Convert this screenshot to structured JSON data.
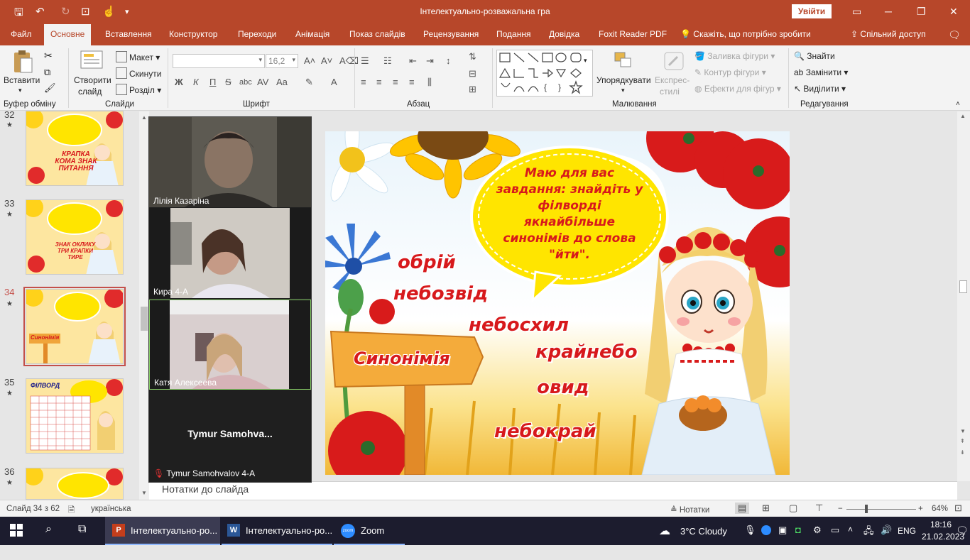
{
  "window": {
    "title": "Інтелектуально-розважальна гра",
    "signin": "Увійти"
  },
  "tabs": [
    "Файл",
    "Основне",
    "Вставлення",
    "Конструктор",
    "Переходи",
    "Анімація",
    "Показ слайдів",
    "Рецензування",
    "Подання",
    "Довідка",
    "Foxit Reader PDF"
  ],
  "tell_me": "Скажіть, що потрібно зробити",
  "share": "Спільний доступ",
  "ribbon": {
    "clipboard": {
      "paste": "Вставити",
      "label": "Буфер обміну"
    },
    "slides": {
      "new_slide_1": "Створити",
      "new_slide_2": "слайд",
      "layout": "Макет",
      "reset": "Скинути",
      "section": "Розділ",
      "label": "Слайди"
    },
    "font": {
      "size": "16,2",
      "bold": "Ж",
      "italic": "К",
      "underline": "П",
      "strike": "S",
      "spacing": "Aa",
      "label": "Шрифт"
    },
    "paragraph": {
      "label": "Абзац"
    },
    "drawing": {
      "arrange": "Упорядкувати",
      "quick_styles_1": "Експрес-",
      "quick_styles_2": "стилі",
      "fill": "Заливка фігури",
      "outline": "Контур фігури",
      "effects": "Ефекти для фігур",
      "label": "Малювання"
    },
    "editing": {
      "find": "Знайти",
      "replace": "Замінити",
      "select": "Виділити",
      "label": "Редагування"
    }
  },
  "slides_panel": [
    {
      "num": "32",
      "star": "★"
    },
    {
      "num": "33",
      "star": "★"
    },
    {
      "num": "34",
      "star": "★"
    },
    {
      "num": "35",
      "star": "★"
    },
    {
      "num": "36",
      "star": "★"
    }
  ],
  "thumb_texts": {
    "t32": "КРАПКА КОМА ЗНАК ПИТАННЯ",
    "t33": "ЗНАК ОКЛИКУ ТРИ КРАПКИ ТИРЕ",
    "t34": "Синонімія",
    "t35": "ФІЛВОРД"
  },
  "slide": {
    "bubble": "Маю для вас завдання: знайдіть у філворді якнайбільше синонімів до слова \"йти\".",
    "sign": "Синонімія",
    "words": [
      "обрій",
      "небозвід",
      "небосхил",
      "крайнебо",
      "овид",
      "небокрай"
    ]
  },
  "zoom": {
    "participants": [
      {
        "name": "Лілія Казаріна"
      },
      {
        "name": "Кира 4-А"
      },
      {
        "name": "Катя Алексеева"
      }
    ],
    "no_video_name": "Tymur  Samohva...",
    "muted_name": "Tymur Samohvalov 4-A"
  },
  "notes_placeholder": "Нотатки до слайда",
  "status": {
    "slide": "Слайд 34 з 62",
    "lang": "українська",
    "notes": "Нотатки",
    "zoom": "64%"
  },
  "taskbar": {
    "apps": [
      "Інтелектуально-ро...",
      "Інтелектуально-ро...",
      "Zoom"
    ],
    "weather": "3°C  Cloudy",
    "lang": "ENG",
    "time": "18:16",
    "date": "21.02.2023"
  },
  "colors": {
    "accent": "#b7472a",
    "slide_red": "#d7191c",
    "taskbar": "#1c1c2e"
  }
}
